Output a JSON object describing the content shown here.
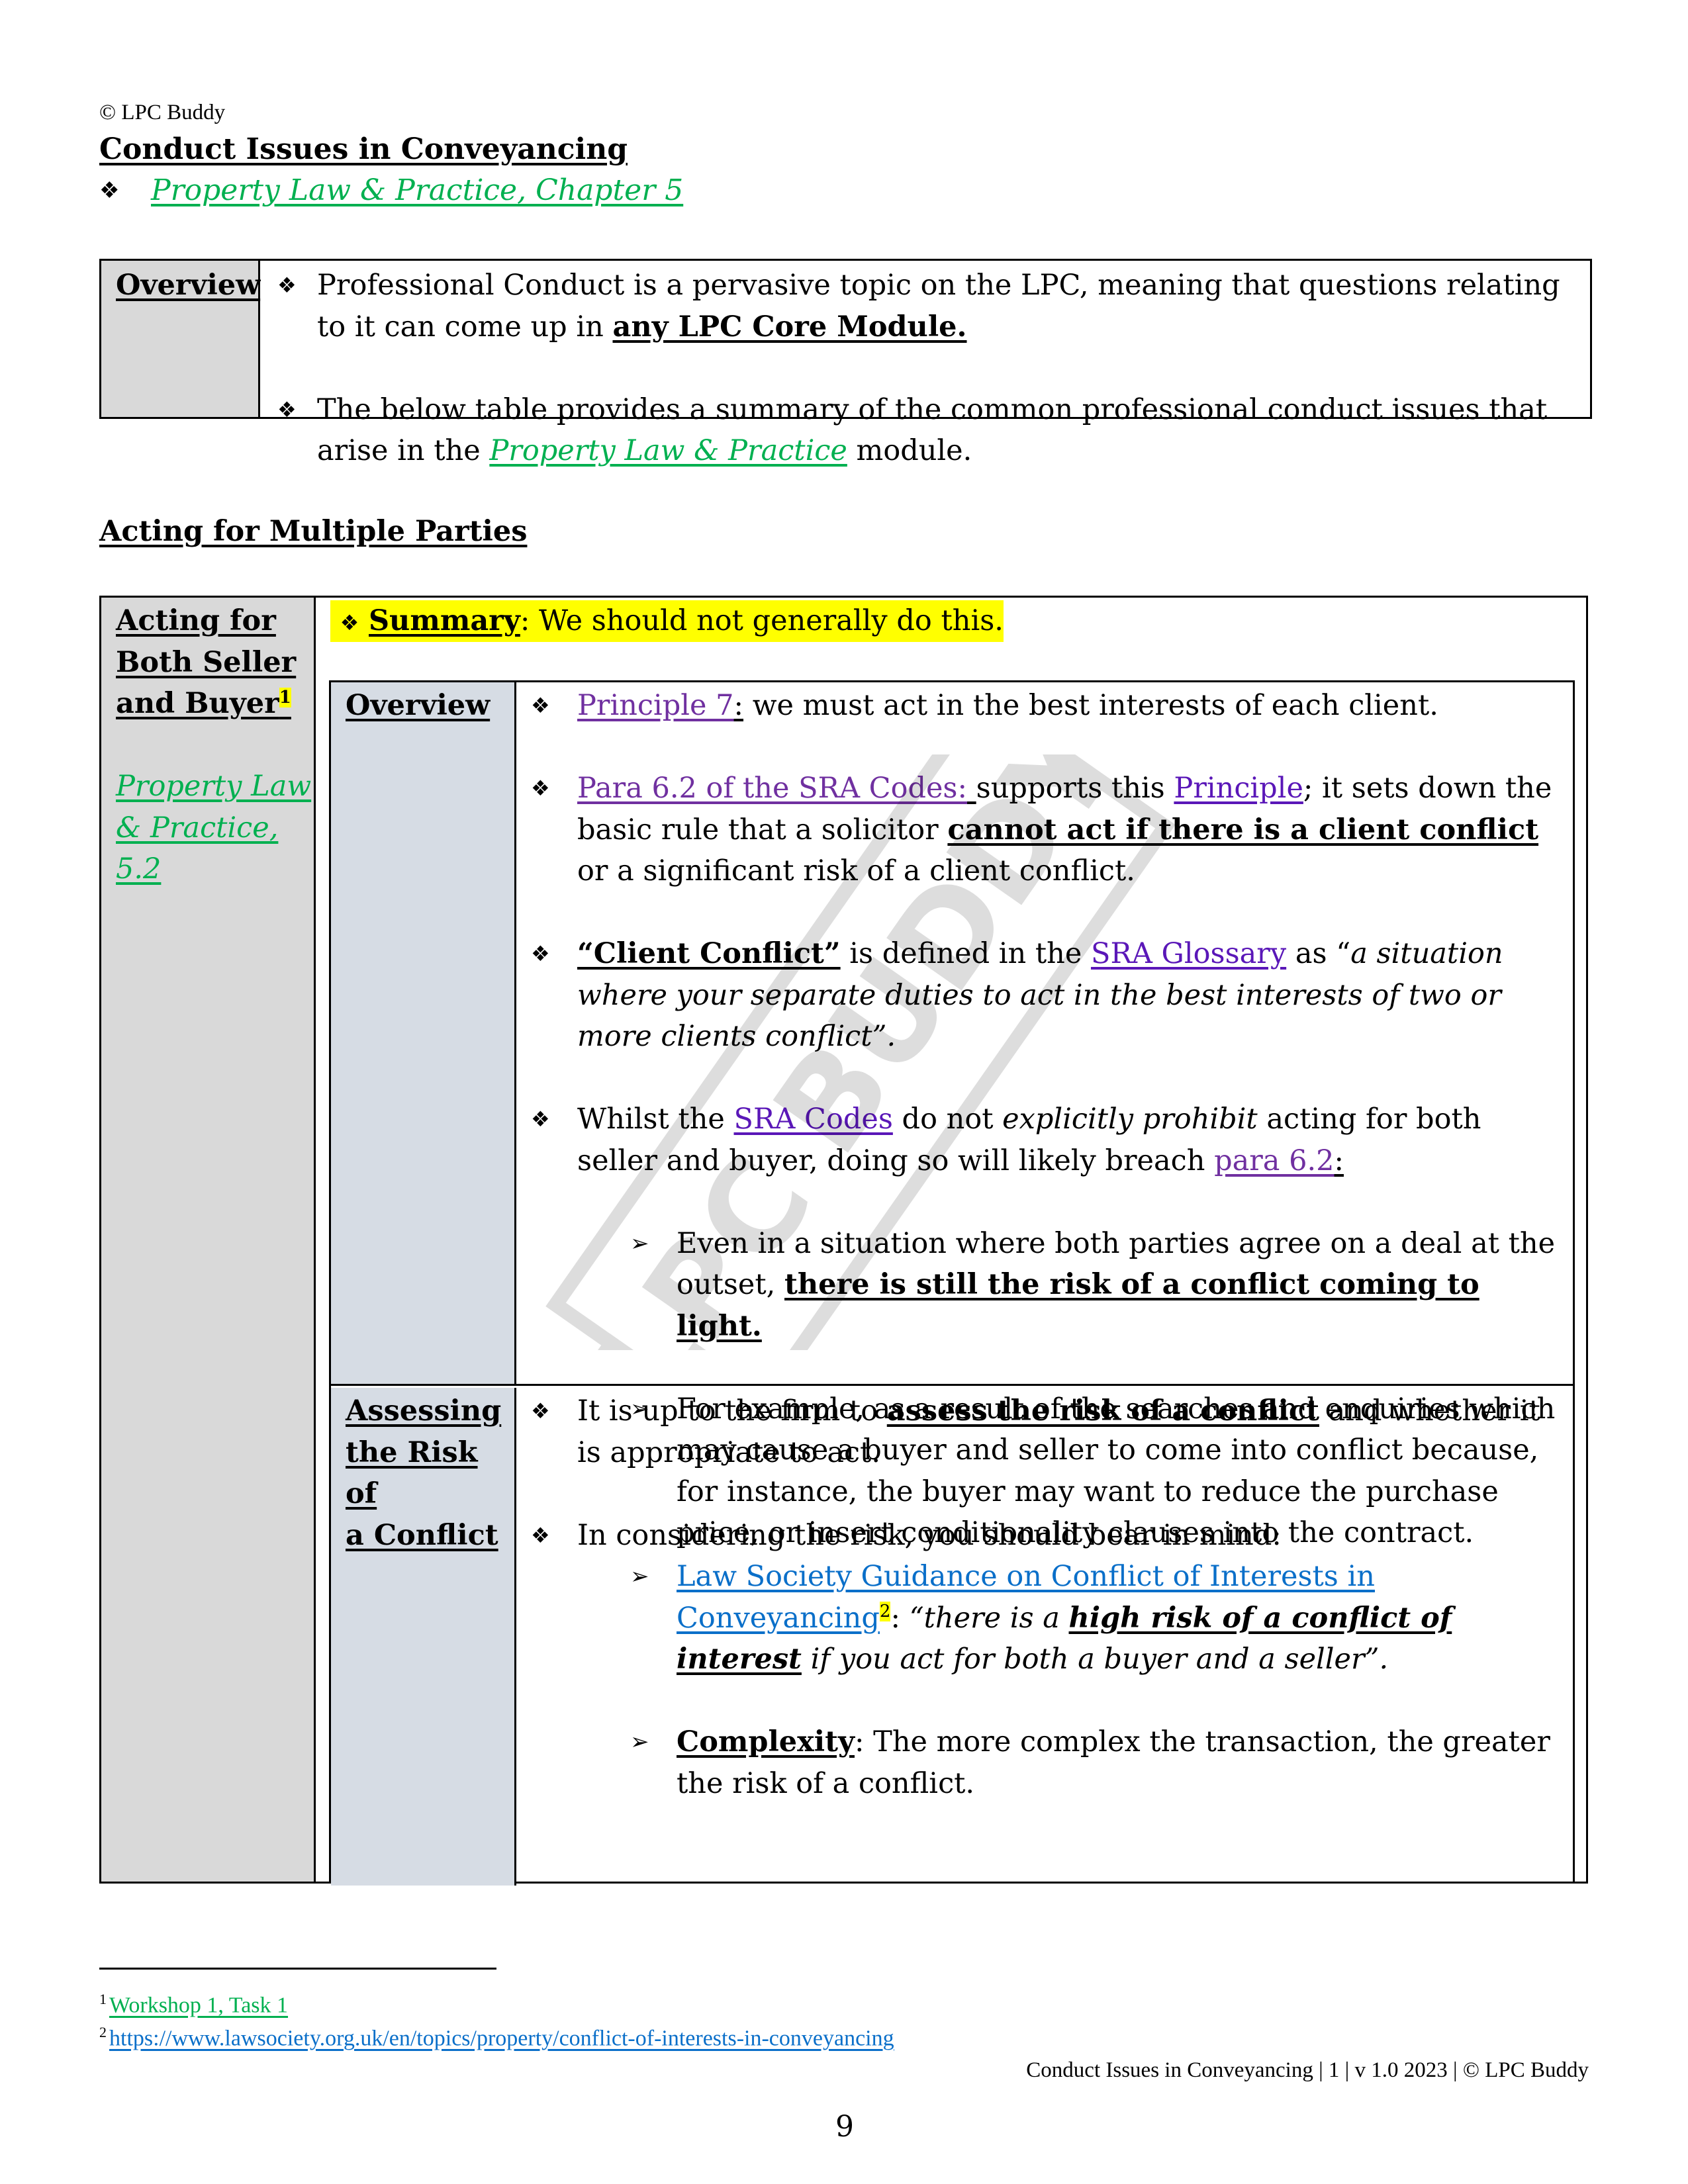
{
  "header": {
    "copyright": "© LPC Buddy",
    "title": "Conduct Issues in Conveyancing",
    "chapter_link": "Property Law & Practice, Chapter 5",
    "bullet_icon": "four-diamond-bullet"
  },
  "overview": {
    "label": "Overview",
    "bullets": [
      {
        "text_before": "Professional Conduct is a pervasive topic on the LPC, meaning that questions relating to it can come up in ",
        "bold_underlined": "any LPC Core Module."
      },
      {
        "text_before": "The below table provides a summary of the common professional conduct issues that arise in the ",
        "link": "Property Law & Practice",
        "text_after": " module."
      }
    ]
  },
  "section": {
    "heading": "Acting for Multiple Parties",
    "row_label_lines": [
      "Acting for",
      "Both Seller",
      "and Buyer"
    ],
    "row_label_footnote": "1",
    "reference_lines": [
      "Property Law",
      "& Practice,",
      "5.2"
    ],
    "summary_label": "Summary",
    "summary_text": ": We should not generally do this.",
    "overview_row": {
      "label": "Overview",
      "b1": {
        "link": "Principle 7",
        "colon": ":",
        "text": " we must act in the best interests of each client."
      },
      "b2": {
        "link": "Para 6.2 of the SRA Codes:",
        "space": " ",
        "text1": "supports this ",
        "link2": "Principle",
        "text2": "; it sets down the basic rule that a solicitor ",
        "bold": "cannot act if there is a client conflict",
        "text3": " or a significant risk of a client conflict."
      },
      "b3": {
        "bold": "“Client Conflict”",
        "text1": " is defined in the ",
        "link": "SRA Glossary",
        "text2": " as “",
        "italic": "a situation where your separate duties to act in the best interests of two or more clients conflict”."
      },
      "b4": {
        "text1": "Whilst the ",
        "link": "SRA Codes",
        "text2": " do not ",
        "italic": "explicitly prohibit",
        "text3": " acting for both seller and buyer, doing so will likely breach ",
        "link2": "para 6.2",
        "colon": ":"
      },
      "sub1": {
        "text": "Even in a situation where both parties agree on a deal at the outset, ",
        "bold": "there is still the risk of a conflict coming to light."
      },
      "sub2": {
        "text": "For example, as a result of the searches and enquiries which may cause a buyer and seller to come into conflict because, for instance, the buyer may want to reduce the purchase price, or insert conditionality clauses into the contract."
      }
    },
    "risk_row": {
      "label_lines": [
        "Assessing",
        "the Risk of",
        "a Conflict"
      ],
      "b1": {
        "text1": "It is up to the firm to ",
        "bold": "assess the risk of a conflict",
        "text2": " and whether it is appropriate to act."
      },
      "b2": {
        "text": "In considering the risk, you should bear in mind:"
      },
      "sub1": {
        "link": "Law Society Guidance on Conflict of Interests in Conveyancing",
        "footnote": "2",
        "colon": ":",
        "q1": "“there is a ",
        "bold": "high risk of a conflict of interest",
        "q2": " if you act for both a buyer and a seller”."
      },
      "sub2": {
        "bold": "Complexity",
        "text": ": The more complex the transaction, the greater the risk of a conflict."
      }
    }
  },
  "watermark": "LPC BUDDY",
  "footnotes": [
    {
      "num": "1",
      "text": "Workshop 1, Task 1"
    },
    {
      "num": "2",
      "text": "https://www.lawsociety.org.uk/en/topics/property/conflict-of-interests-in-conveyancing"
    }
  ],
  "footer": "Conduct Issues in Conveyancing | 1 | v 1.0 2023 | © LPC Buddy",
  "page_number": "9",
  "colors": {
    "link_green": "#00b050",
    "link_purple": "#7030a0",
    "link_blue": "#0a6fc9",
    "highlight": "#ffff00",
    "label_gray": "#d9d9d9",
    "label_bluegray": "#d6dce4"
  }
}
